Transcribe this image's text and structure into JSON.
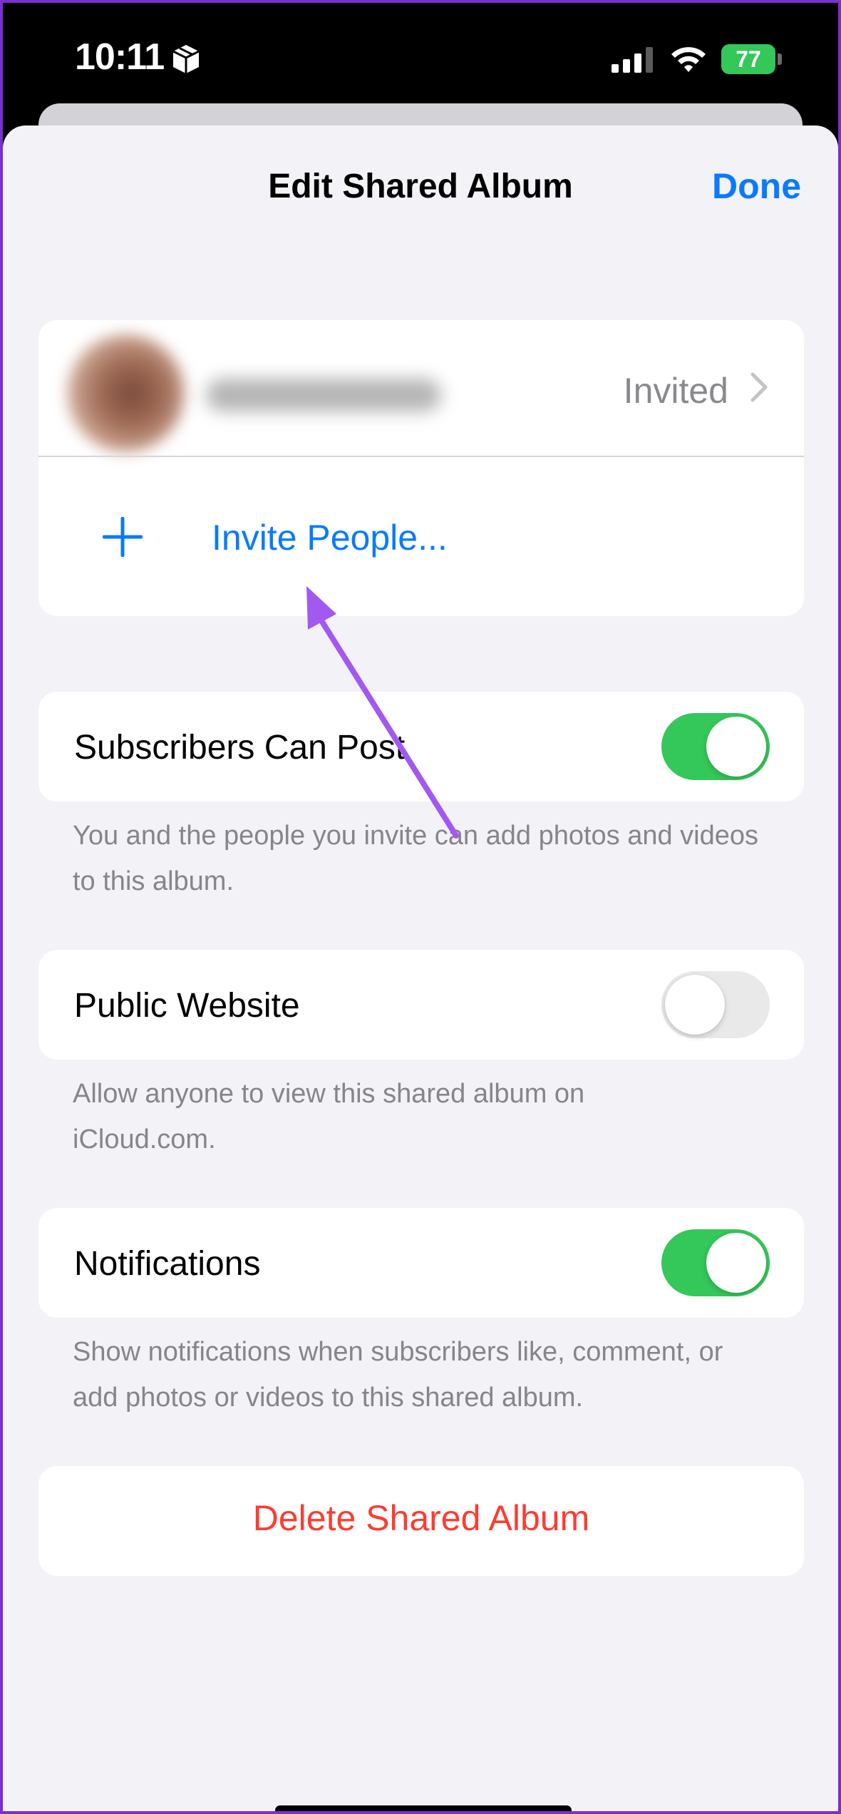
{
  "status_bar": {
    "time": "10:11",
    "battery_level": "77",
    "icons": [
      "package-icon",
      "cellular-signal-icon",
      "wifi-icon",
      "battery-charging-icon"
    ]
  },
  "nav": {
    "title": "Edit Shared Album",
    "done_label": "Done"
  },
  "people": {
    "invitee_status": "Invited",
    "invite_label": "Invite People..."
  },
  "settings": {
    "subscribers_can_post": {
      "label": "Subscribers Can Post",
      "enabled": true,
      "footer": "You and the people you invite can add photos and videos to this album."
    },
    "public_website": {
      "label": "Public Website",
      "enabled": false,
      "footer": "Allow anyone to view this shared album on iCloud.com."
    },
    "notifications": {
      "label": "Notifications",
      "enabled": true,
      "footer": "Show notifications when subscribers like, comment, or add photos or videos to this shared album."
    }
  },
  "delete_label": "Delete Shared Album",
  "colors": {
    "accent": "#0a7aff",
    "toggle_on": "#34c759",
    "destructive": "#ff3b30",
    "annotation_arrow": "#a259f0",
    "frame_border": "#7a2fd0"
  }
}
